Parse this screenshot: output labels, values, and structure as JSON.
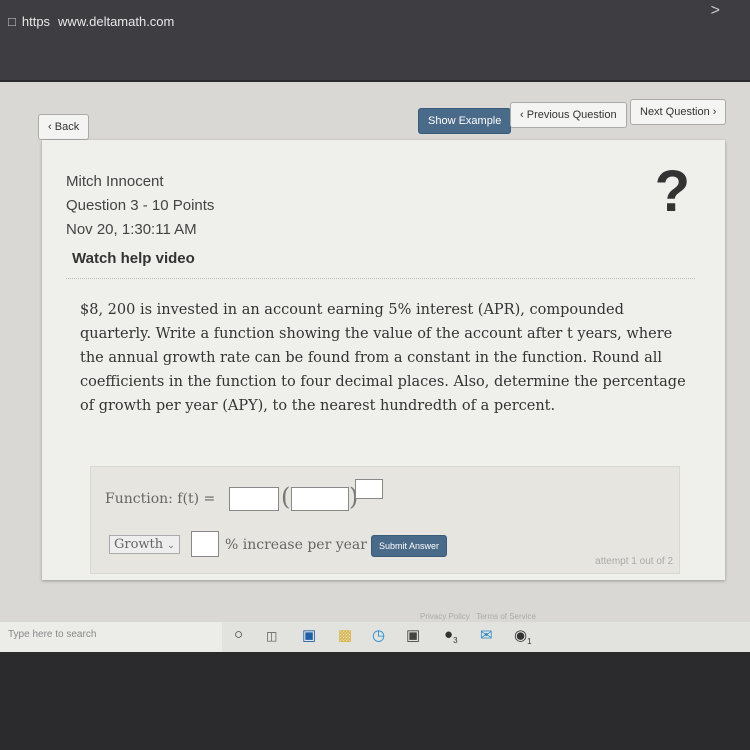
{
  "browser": {
    "protocol": "https",
    "url": "www.deltamath.com"
  },
  "nav": {
    "back": "Back",
    "show_example": "Show Example",
    "previous": "Previous Question",
    "next": "Next Question"
  },
  "info": {
    "student": "Mitch Innocent",
    "question": "Question 3 - 10 Points",
    "datetime": "Nov 20, 1:30:11 AM",
    "help": "Watch help video",
    "help_icon": "question-mark"
  },
  "question": {
    "text": "$8, 200 is invested in an account earning 5% interest (APR), compounded quarterly. Write a function showing the value of the account after t years, where the annual growth rate can be found from a constant in the function. Round all coefficients in the function to four decimal places. Also, determine the percentage of growth per year (APY), to the nearest hundredth of a percent."
  },
  "answer": {
    "function_label": "Function: f(t) =",
    "select_value": "Growth",
    "pct_label": "% increase per year",
    "submit": "Submit Answer",
    "attempt": "attempt 1 out of 2"
  },
  "footer": {
    "privacy": "Privacy Policy",
    "terms": "Terms of Service"
  },
  "taskbar": {
    "search_placeholder": "Type here to search",
    "badge_1": "3",
    "badge_2": "1"
  }
}
